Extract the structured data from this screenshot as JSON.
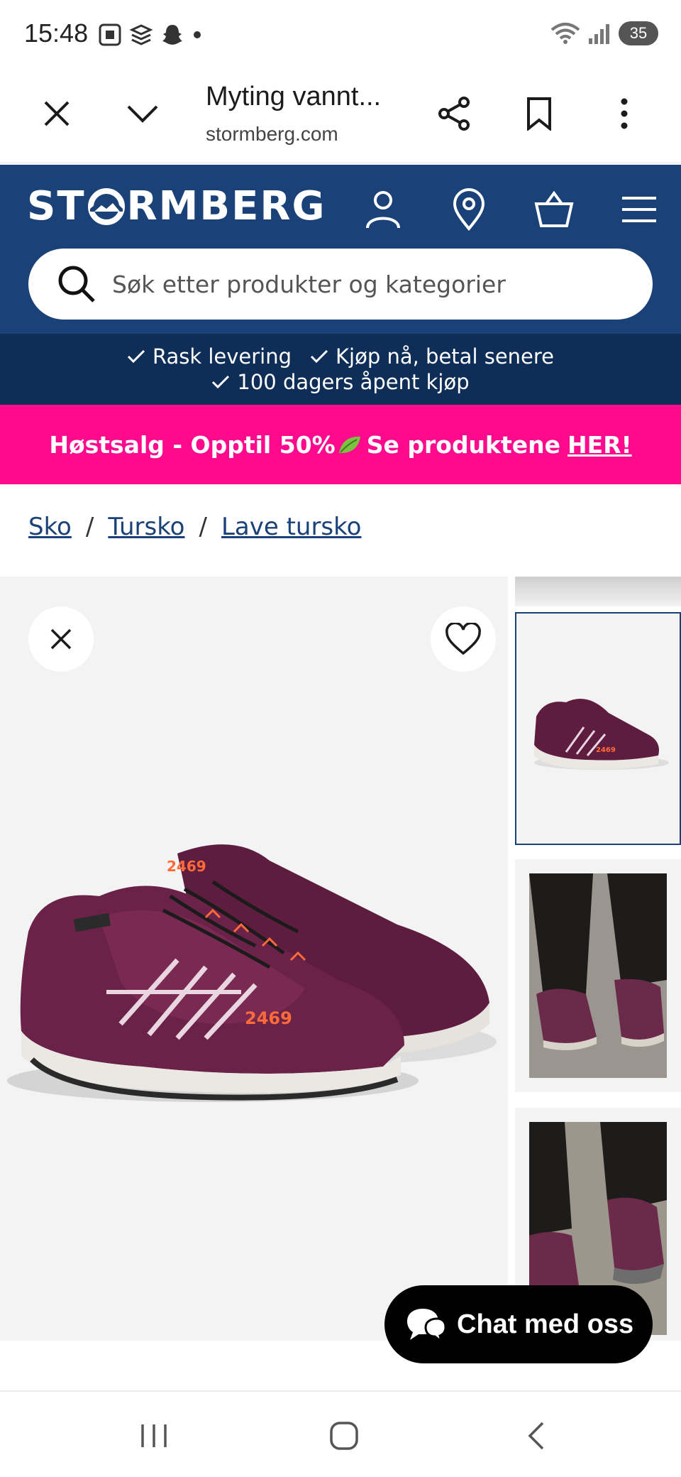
{
  "status_bar": {
    "time": "15:48",
    "battery": "35",
    "icons_left": [
      "screenshot-icon",
      "stack-icon",
      "snapchat-icon",
      "dot-icon"
    ],
    "icons_right": [
      "wifi-icon",
      "signal-icon",
      "battery-icon"
    ]
  },
  "browser": {
    "title": "Myting vannt...",
    "url": "stormberg.com",
    "icons": [
      "close-icon",
      "chevron-down-icon",
      "share-icon",
      "bookmark-icon",
      "more-icon"
    ]
  },
  "header": {
    "logo_left": "ST",
    "logo_right": "RMBERG",
    "icons": [
      "user-icon",
      "location-pin-icon",
      "shopping-basket-icon",
      "menu-icon"
    ],
    "search_placeholder": "Søk etter produkter og kategorier",
    "brand_color": "#1a4278"
  },
  "usp": {
    "items": [
      "Rask levering",
      "Kjøp nå, betal senere",
      "100 dagers åpent kjøp"
    ]
  },
  "promo": {
    "text": "Høstsalg - Opptil 50%",
    "text2": "Se produktene",
    "link": "HER!",
    "color": "#ff0a8c"
  },
  "breadcrumb": {
    "items": [
      "Sko",
      "Tursko",
      "Lave tursko"
    ],
    "separator": "/"
  },
  "gallery": {
    "thumbnails": [
      "product-thumb",
      "lifestyle-photo-1",
      "lifestyle-photo-2"
    ],
    "shoe_label": "2469",
    "shoe_color": "#5e1d3f"
  },
  "chat": {
    "label": "Chat med oss"
  },
  "system_nav": [
    "recent-apps-icon",
    "home-icon",
    "back-icon"
  ]
}
